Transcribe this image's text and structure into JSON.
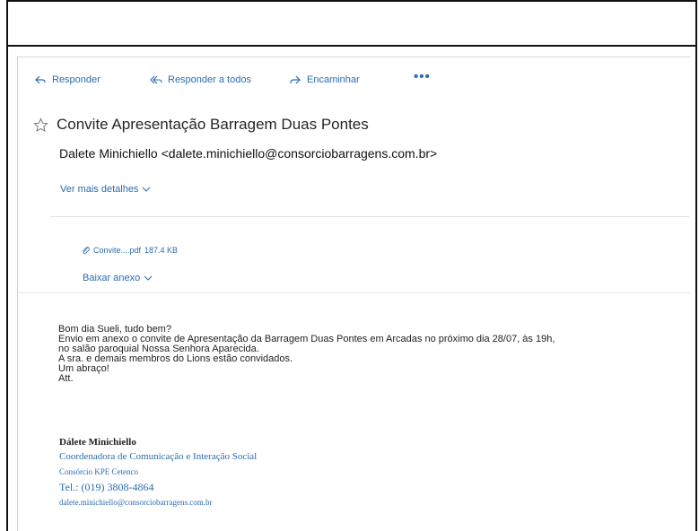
{
  "toolbar": {
    "reply_label": "Responder",
    "reply_all_label": "Responder a todos",
    "forward_label": "Encaminhar",
    "more_label": "•••"
  },
  "message": {
    "subject": "Convite Apresentação Barragem Duas Pontes",
    "sender": "Dalete Minichiello <dalete.minichiello@consorciobarragens.com.br>",
    "details_label": "Ver mais detalhes",
    "attachment_name": "Convite....pdf",
    "attachment_size": "187.4 KB",
    "download_label": "Baixar anexo"
  },
  "body": {
    "lines": [
      "Bom dia Sueli, tudo bem?",
      "Envio em anexo o convite de Apresentação da Barragem Duas Pontes em Arcadas no próximo dia 28/07, às 19h,",
      "no salão paroquial Nossa Senhora Aparecida.",
      "A sra. e demais membros do Lions estão convidados.",
      "Um abraço!",
      "Att."
    ]
  },
  "signature": {
    "name": "Dálete Minichiello",
    "role": "Coordenadora de Comunicação e Interação Social",
    "company": "Consórcio KPE Cetenco",
    "tel": "Tel.: (019) 3808-4864",
    "email": "dalete.minichiello@consorciobarragens.com.br"
  },
  "colors": {
    "accent": "#2b6cb0",
    "text": "#222222"
  }
}
